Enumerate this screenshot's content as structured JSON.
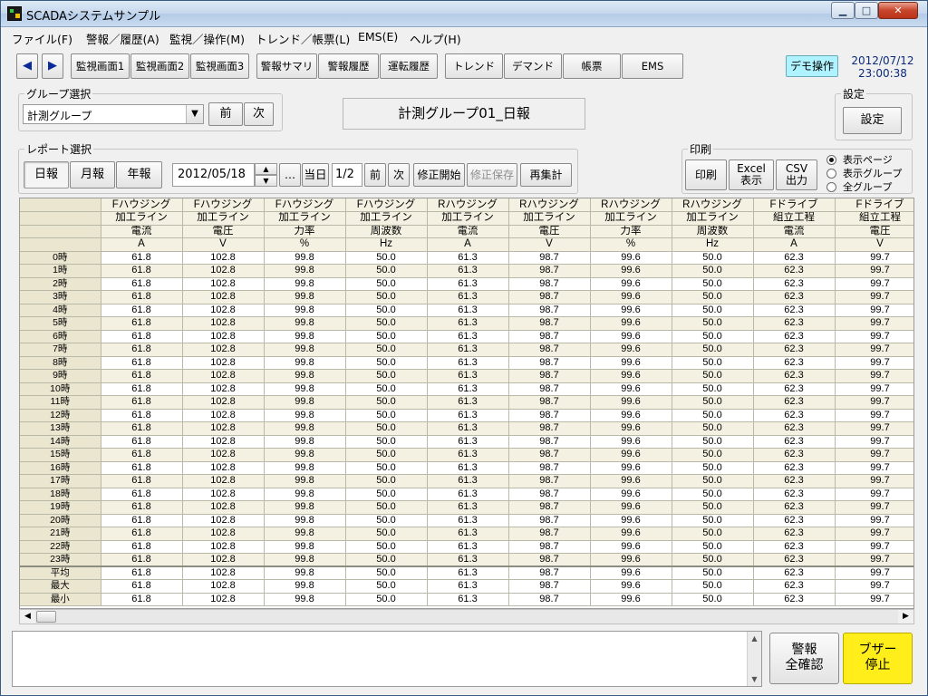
{
  "window": {
    "title": "SCADAシステムサンプル",
    "min": "▁",
    "max": "□",
    "close": "✕"
  },
  "menu": [
    "ファイル(F)",
    "警報／履歴(A)",
    "監視／操作(M)",
    "トレンド／帳票(L)",
    "EMS(E)",
    "ヘルプ(H)"
  ],
  "toolbar": {
    "back": "◀",
    "forward": "▶",
    "buttons": [
      "監視画面1",
      "監視画面2",
      "監視画面3",
      "警報サマリ",
      "警報履歴",
      "運転履歴",
      "トレンド",
      "デマンド",
      "帳票",
      "EMS"
    ],
    "demo": "デモ操作",
    "date": "2012/07/12",
    "time": "23:00:38"
  },
  "group_select": {
    "label": "グループ選択",
    "value": "計測グループ",
    "arrow": "▼",
    "prev": "前",
    "next": "次"
  },
  "report_title": "計測グループ01_日報",
  "settings": {
    "label": "設定",
    "button": "設定"
  },
  "report_select": {
    "label": "レポート選択",
    "daily": "日報",
    "monthly": "月報",
    "yearly": "年報",
    "date": "2012/05/18",
    "spin_up": "▲",
    "spin_down": "▼",
    "ellipsis": "…",
    "today": "当日",
    "page": "1/2",
    "prev": "前",
    "next": "次",
    "edit_start": "修正開始",
    "edit_save": "修正保存",
    "recalc": "再集計"
  },
  "print": {
    "label": "印刷",
    "print": "印刷",
    "excel_1": "Excel",
    "excel_2": "表示",
    "csv_1": "CSV",
    "csv_2": "出力",
    "options": [
      "表示ページ",
      "表示グループ",
      "全グループ"
    ],
    "selected": 0
  },
  "table": {
    "columns": [
      {
        "h1": "Fハウジング",
        "h2": "加工ライン",
        "h3": "電流",
        "unit": "A"
      },
      {
        "h1": "Fハウジング",
        "h2": "加工ライン",
        "h3": "電圧",
        "unit": "V"
      },
      {
        "h1": "Fハウジング",
        "h2": "加工ライン",
        "h3": "力率",
        "unit": "%"
      },
      {
        "h1": "Fハウジング",
        "h2": "加工ライン",
        "h3": "周波数",
        "unit": "Hz"
      },
      {
        "h1": "Rハウジング",
        "h2": "加工ライン",
        "h3": "電流",
        "unit": "A"
      },
      {
        "h1": "Rハウジング",
        "h2": "加工ライン",
        "h3": "電圧",
        "unit": "V"
      },
      {
        "h1": "Rハウジング",
        "h2": "加工ライン",
        "h3": "力率",
        "unit": "%"
      },
      {
        "h1": "Rハウジング",
        "h2": "加工ライン",
        "h3": "周波数",
        "unit": "Hz"
      },
      {
        "h1": "Fドライブ",
        "h2": "組立工程",
        "h3": "電流",
        "unit": "A"
      },
      {
        "h1": "Fドライブ",
        "h2": "組立工程",
        "h3": "電圧",
        "unit": "V"
      }
    ],
    "hours": [
      "0時",
      "1時",
      "2時",
      "3時",
      "4時",
      "5時",
      "6時",
      "7時",
      "8時",
      "9時",
      "10時",
      "11時",
      "12時",
      "13時",
      "14時",
      "15時",
      "16時",
      "17時",
      "18時",
      "19時",
      "20時",
      "21時",
      "22時",
      "23時"
    ],
    "hour_values": [
      "61.8",
      "102.8",
      "99.8",
      "50.0",
      "61.3",
      "98.7",
      "99.6",
      "50.0",
      "62.3",
      "99.7"
    ],
    "summary_labels": [
      "平均",
      "最大",
      "最小"
    ],
    "summary_values": [
      "61.8",
      "102.8",
      "99.8",
      "50.0",
      "61.3",
      "98.7",
      "99.6",
      "50.0",
      "62.3",
      "99.7"
    ]
  },
  "scroll": {
    "left": "◀",
    "right": "▶",
    "up": "▲",
    "down": "▼"
  },
  "alarm_ack": {
    "line1": "警報",
    "line2": "全確認"
  },
  "buzzer_stop": {
    "line1": "ブザー",
    "line2": "停止"
  },
  "colors": {
    "demo_bg": "#aef3ff",
    "buzzer_bg": "#ffee1a",
    "grid_alt": "#f4f1e2",
    "grid_label": "#ebe6d0"
  }
}
